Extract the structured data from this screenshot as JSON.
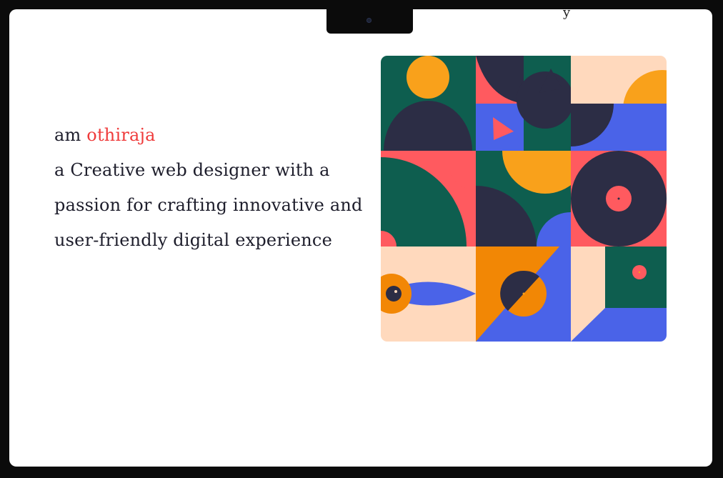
{
  "hero": {
    "prefix": "am ",
    "name": "othiraja",
    "line2": "a Creative web designer with a",
    "line3": "passion for crafting innovative and",
    "line4": "user-friendly digital experience"
  },
  "clipped_text": "y",
  "colors": {
    "name_accent": "#ef3b3b",
    "dark": "#2c2d45",
    "green": "#0e5e4f",
    "orange": "#f9a11b",
    "coral": "#ff5a5f",
    "blue": "#4a63e8",
    "peach": "#ffd9bd",
    "deep_orange": "#f28705"
  },
  "artwork": {
    "name": "geometric-pattern-illustration"
  }
}
